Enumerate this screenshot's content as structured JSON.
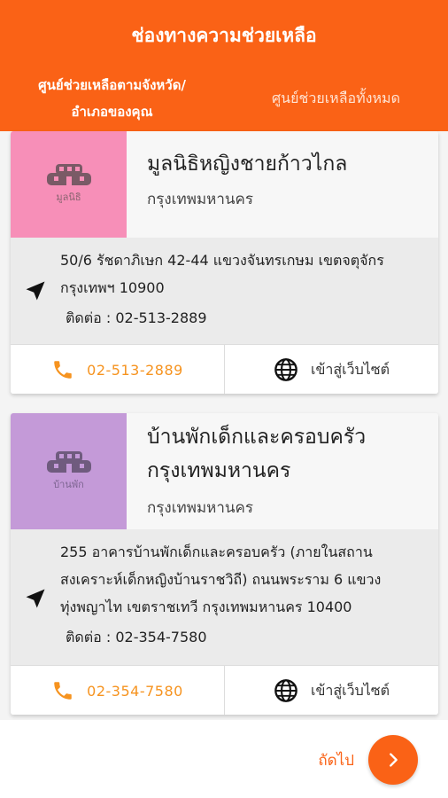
{
  "header": {
    "title": "ช่องทางความช่วยเหลือ",
    "tabs": [
      {
        "label_line1": "ศูนย์ช่วยเหลือตามจังหวัด/",
        "label_line2": "อำเภอของคุณ",
        "active": true
      },
      {
        "label": "ศูนย์ช่วยเหลือทั้งหมด",
        "active": false
      }
    ]
  },
  "cards": [
    {
      "thumb_color": "#f78fb8",
      "thumb_caption": "มูลนิธิ",
      "name": "มูลนิธิหญิงชายก้าวไกล",
      "province": "กรุงเทพมหานคร",
      "address_lines": [
        "50/6 รัชดาภิเษก 42-44 แขวงจันทรเกษม เขตจตุจักร",
        "กรุงเทพฯ 10900"
      ],
      "contact": "ติดต่อ : 02-513-2889",
      "phone": "02-513-2889",
      "web_label": "เข้าสู่เว็บไซต์"
    },
    {
      "thumb_color": "#c49ad8",
      "thumb_caption": "บ้านพัก",
      "name_lines": [
        "บ้านพักเด็กและครอบครัว",
        "กรุงเทพมหานคร"
      ],
      "province": "กรุงเทพมหานคร",
      "address_lines": [
        "255 อาคารบ้านพักเด็กและครอบครัว (ภายในสถาน",
        "สงเคราะห์เด็กหญิงบ้านราชวิถี) ถนนพระราม 6 แขวง",
        "ทุ่งพญาไท เขตราชเทวี กรุงเทพมหานคร 10400"
      ],
      "contact": "ติดต่อ : 02-354-7580",
      "phone": "02-354-7580",
      "web_label": "เข้าสู่เว็บไซต์"
    }
  ],
  "footer": {
    "next_label": "ถัดไป"
  },
  "colors": {
    "primary": "#fa6216",
    "phone_accent": "#f6931f"
  }
}
